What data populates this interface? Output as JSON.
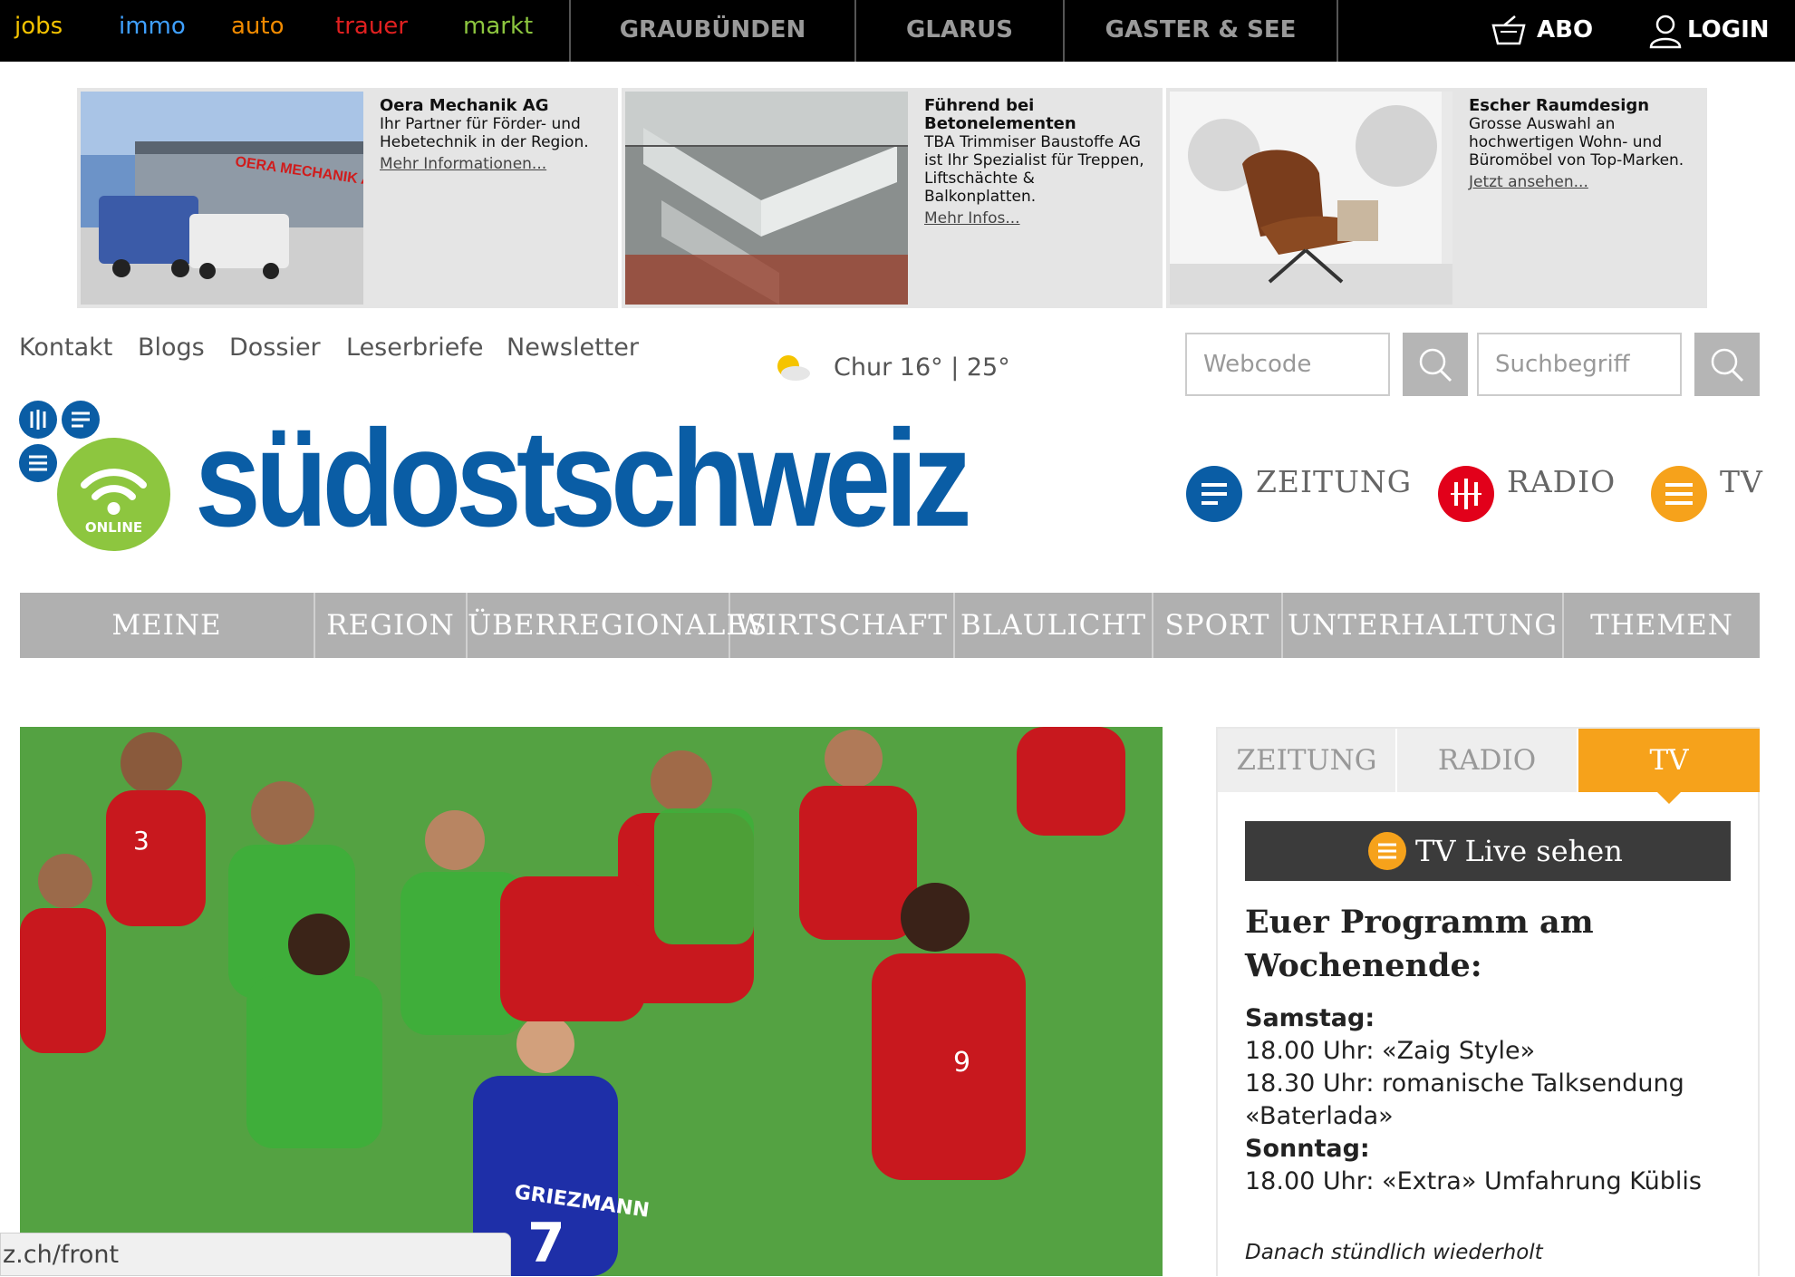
{
  "topbar": {
    "portals": [
      {
        "label": "jobs",
        "color": "#f3c200"
      },
      {
        "label": "immo",
        "color": "#3fa0ff"
      },
      {
        "label": "auto",
        "color": "#f08a00"
      },
      {
        "label": "trauer",
        "color": "#e02020"
      },
      {
        "label": "markt",
        "color": "#8dc63f"
      }
    ],
    "regions": [
      "GRAUBÜNDEN",
      "GLARUS",
      "GASTER & SEE"
    ],
    "abo_label": "ABO",
    "login_label": "LOGIN"
  },
  "ads": [
    {
      "title": "Oera Mechanik AG",
      "body": "Ihr Partner für Förder- und Hebetechnik in der Region.",
      "link": "Mehr Informationen..."
    },
    {
      "title": "Führend bei Betonelementen",
      "body": "TBA Trimmiser Baustoffe AG ist Ihr Spezialist für Treppen, Liftschächte & Balkonplatten.",
      "link": "Mehr Infos..."
    },
    {
      "title": "Escher Raumdesign",
      "body": "Grosse Auswahl an hochwertigen Wohn- und Büromöbel von Top-Marken.",
      "link": "Jetzt ansehen..."
    }
  ],
  "subnav": [
    "Kontakt",
    "Blogs",
    "Dossier",
    "Leserbriefe",
    "Newsletter"
  ],
  "weather": {
    "text": "Chur 16° | 25°",
    "icon": "partly-sunny-icon"
  },
  "search": {
    "webcode_placeholder": "Webcode",
    "term_placeholder": "Suchbegriff"
  },
  "logo": {
    "text": "südostschweiz",
    "badge": "ONLINE"
  },
  "media": [
    "ZEITUNG",
    "RADIO",
    "TV"
  ],
  "mainnav": [
    "MEINE GEMEINDE",
    "REGION",
    "ÜBERREGIONALES",
    "WIRTSCHAFT",
    "BLAULICHT",
    "SPORT",
    "UNTERHALTUNG",
    "THEMEN"
  ],
  "hero": {
    "player_name": "GRIEZMANN",
    "numbers": [
      "3",
      "9",
      "7"
    ]
  },
  "sidebar": {
    "tabs": [
      "ZEITUNG",
      "RADIO",
      "TV"
    ],
    "live_label": "TV Live sehen",
    "heading": "Euer Programm am Wochenende:",
    "lines": [
      {
        "text": "Samstag:",
        "bold": true
      },
      {
        "text": "18.00 Uhr: «Zaig Style»",
        "bold": false
      },
      {
        "text": "18.30 Uhr: romanische Talksendung",
        "bold": false
      },
      {
        "text": "«Baterlada»",
        "bold": false
      },
      {
        "text": "Sonntag:",
        "bold": true
      },
      {
        "text": "18.00 Uhr: «Extra» Umfahrung Küblis",
        "bold": false
      }
    ],
    "footnote": "Danach stündlich wiederholt"
  },
  "statusbar": {
    "url": "z.ch/front"
  },
  "colors": {
    "brand_blue": "#0a5da5",
    "online_green": "#8dc63f",
    "radio_red": "#e2001a",
    "tv_orange": "#f6a21b"
  }
}
